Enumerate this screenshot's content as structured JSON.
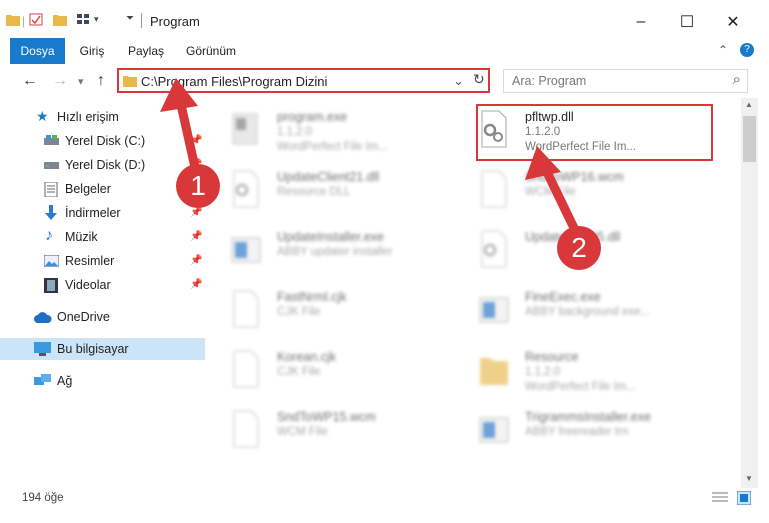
{
  "window": {
    "title": "Program",
    "minimize": "–",
    "maximize": "☐",
    "close": "✕"
  },
  "ribbon": {
    "tabs": [
      "Dosya",
      "Giriş",
      "Paylaş",
      "Görünüm"
    ],
    "expand": "⌃",
    "help": "?"
  },
  "nav": {
    "back": "←",
    "forward": "→",
    "recent": "▾",
    "up": "↑"
  },
  "address": {
    "path": "C:\\Program Files\\Program Dizini",
    "dropdown": "⌄",
    "refresh": "↻"
  },
  "search": {
    "placeholder": "Ara: Program",
    "icon": "⌕"
  },
  "sidebar": {
    "items": [
      {
        "label": "Hızlı erişim",
        "icon": "star-icon"
      },
      {
        "label": "Yerel Disk (C:)",
        "icon": "drive-icon",
        "pinned": true
      },
      {
        "label": "Yerel Disk (D:)",
        "icon": "drive-icon",
        "pinned": true
      },
      {
        "label": "Belgeler",
        "icon": "document-icon",
        "pinned": true
      },
      {
        "label": "İndirmeler",
        "icon": "download-icon",
        "pinned": true
      },
      {
        "label": "Müzik",
        "icon": "music-icon",
        "pinned": true
      },
      {
        "label": "Resimler",
        "icon": "pictures-icon",
        "pinned": true
      },
      {
        "label": "Videolar",
        "icon": "video-icon",
        "pinned": true
      },
      {
        "label": "OneDrive",
        "icon": "cloud-icon"
      },
      {
        "label": "Bu bilgisayar",
        "icon": "computer-icon",
        "selected": true
      },
      {
        "label": "Ağ",
        "icon": "network-icon"
      }
    ]
  },
  "files": [
    {
      "name": "program.exe",
      "line1": "1.1.2.0",
      "line2": "WordPerfect File Im...",
      "icon": "exe-icon"
    },
    {
      "name": "pfltwp.dll",
      "line1": "1.1.2.0",
      "line2": "WordPerfect File Im...",
      "icon": "dll-gear-icon",
      "highlighted": true
    },
    {
      "name": "UpdateClient21.dll",
      "line1": "Resource DLL",
      "line2": "",
      "icon": "dll-gear-icon"
    },
    {
      "name": "SndToWP16.wcm",
      "line1": "WCM File",
      "line2": "",
      "icon": "file-icon"
    },
    {
      "name": "UpdateInstaller.exe",
      "line1": "ABBY updater installer",
      "line2": "",
      "icon": "window-app-icon"
    },
    {
      "name": "UpdateClient5.dll",
      "line1": "",
      "line2": "",
      "icon": "dll-gear-icon"
    },
    {
      "name": "FastNrml.cjk",
      "line1": "CJK File",
      "line2": "",
      "icon": "file-icon"
    },
    {
      "name": "FineExec.exe",
      "line1": "ABBY background exe...",
      "line2": "",
      "icon": "window-app-icon"
    },
    {
      "name": "Korean.cjk",
      "line1": "CJK File",
      "line2": "",
      "icon": "file-icon"
    },
    {
      "name": "Resource",
      "line1": "1.1.2.0",
      "line2": "WordPerfect File Im...",
      "icon": "folder-icon"
    },
    {
      "name": "SndToWP15.wcm",
      "line1": "WCM File",
      "line2": "",
      "icon": "file-icon"
    },
    {
      "name": "TrigrammsInstaller.exe",
      "line1": "ABBY freereader trn",
      "line2": "",
      "icon": "window-app-icon"
    }
  ],
  "annotations": {
    "badge1": "1",
    "badge2": "2"
  },
  "status": {
    "count": "194 öğe"
  },
  "colors": {
    "accent": "#1979ca",
    "highlight": "#d9383a",
    "selected": "#cce4f7"
  }
}
